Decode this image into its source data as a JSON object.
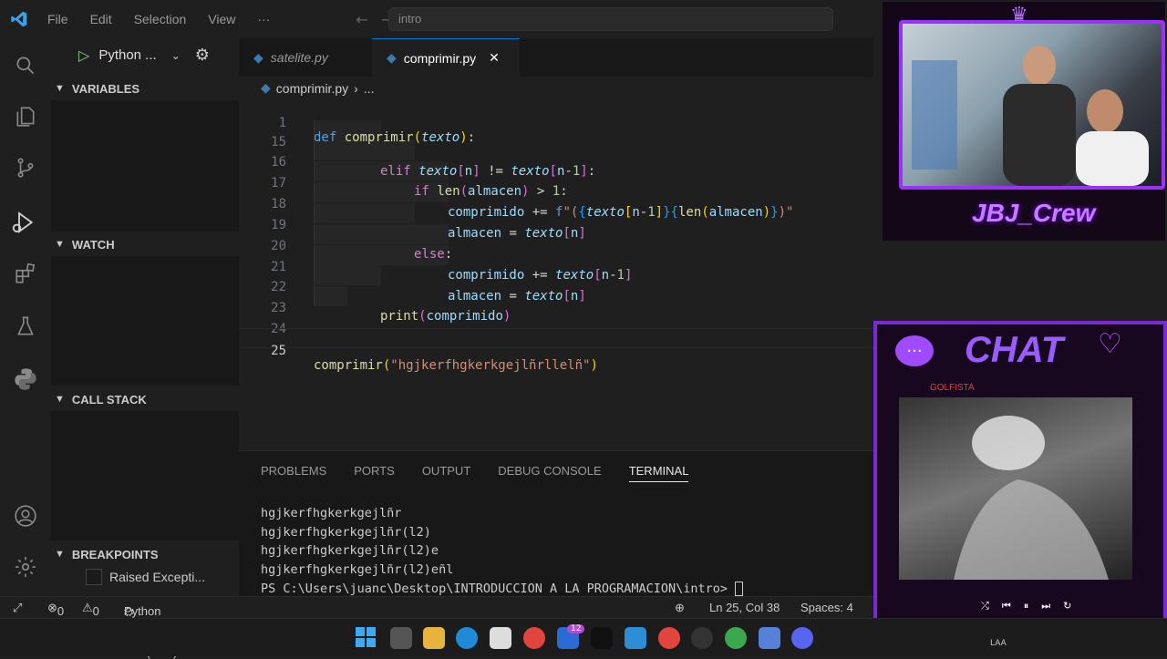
{
  "menu": [
    "File",
    "Edit",
    "Selection",
    "View",
    "···"
  ],
  "search": {
    "placeholder": "intro"
  },
  "run": {
    "config": "Python ..."
  },
  "tabs": [
    {
      "label": "satelite.py",
      "active": false
    },
    {
      "label": "comprimir.py",
      "active": true
    }
  ],
  "breadcrumb": {
    "file": "comprimir.py",
    "more": "..."
  },
  "sidebar": {
    "variables": "VARIABLES",
    "watch": "WATCH",
    "call_stack": "CALL STACK",
    "breakpoints": "BREAKPOINTS",
    "breakpoint_item": "Raised Excepti..."
  },
  "code": {
    "sticky": {
      "num": "1",
      "text": "def comprimir(texto):"
    },
    "lines": [
      {
        "num": "15",
        "text": "elif texto[n] != texto[n-1]:"
      },
      {
        "num": "16",
        "text": "if len(almacen) > 1:"
      },
      {
        "num": "17",
        "text": "comprimido += f\"({texto[n-1]}{len(almacen)})\""
      },
      {
        "num": "18",
        "text": "almacen = texto[n]"
      },
      {
        "num": "19",
        "text": "else:"
      },
      {
        "num": "20",
        "text": "comprimido += texto[n-1]"
      },
      {
        "num": "21",
        "text": "almacen = texto[n]"
      },
      {
        "num": "22",
        "text": "print(comprimido)"
      },
      {
        "num": "23",
        "text": ""
      },
      {
        "num": "24",
        "text": ""
      },
      {
        "num": "25",
        "text": "comprimir(\"hgjkerfhgkerkgejlñrllelñ\")"
      }
    ]
  },
  "panel": {
    "tabs": [
      "PROBLEMS",
      "PORTS",
      "OUTPUT",
      "DEBUG CONSOLE",
      "TERMINAL"
    ],
    "active_tab": "TERMINAL",
    "terminal_lines": [
      "hgjkerfhgkerkgejlñr",
      "hgjkerfhgkerkgejlñr(l2)",
      "hgjkerfhgkerkgejlñr(l2)e",
      "hgjkerfhgkerkgejlñr(l2)eñl",
      "PS C:\\Users\\juanc\\Desktop\\INTRODUCCION A LA PROGRAMACION\\intro> "
    ]
  },
  "status": {
    "errors": "0",
    "warnings": "0",
    "debugger": "Python Debugger: Python File (intro)",
    "position": "Ln 25, Col 38",
    "spaces": "Spaces: 4"
  },
  "overlay": {
    "crew": "JBJ_Crew",
    "chat_title": "CHAT",
    "chat_user": "GOLFISTA",
    "taskbar_badge": "12",
    "tray": "LAA"
  },
  "colors": {
    "purple": "#9b30ff",
    "accent": "#0078d4"
  }
}
